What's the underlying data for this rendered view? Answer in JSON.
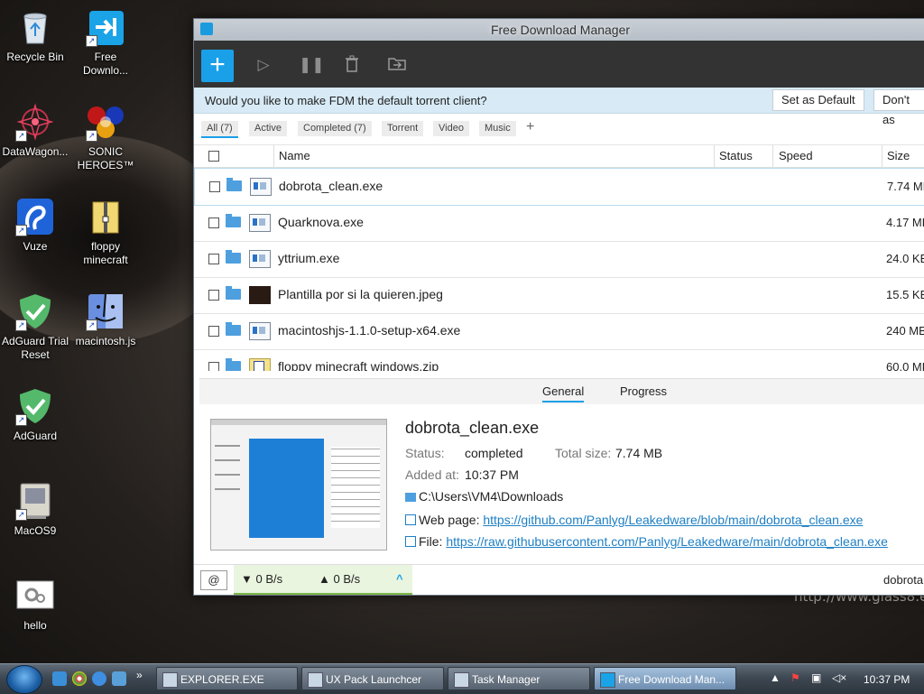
{
  "wallpaper": {
    "watermark": "http://www.glass8.eu"
  },
  "desktop_icons": [
    {
      "label": "Recycle Bin"
    },
    {
      "label": "Free Downlo..."
    },
    {
      "label": "DataWagon..."
    },
    {
      "label": "SONIC HEROES™"
    },
    {
      "label": "Vuze"
    },
    {
      "label": "floppy minecraft"
    },
    {
      "label": "AdGuard Trial Reset"
    },
    {
      "label": "macintosh.js"
    },
    {
      "label": "AdGuard"
    },
    {
      "label": "MacOS9"
    },
    {
      "label": "hello"
    }
  ],
  "window": {
    "title": "Free Download Manager",
    "notice": {
      "message": "Would you like to make FDM the default torrent client?",
      "set_default": "Set as Default",
      "dont_ask": "Don't as"
    },
    "filters": [
      "All (7)",
      "Active",
      "Completed (7)",
      "Torrent",
      "Video",
      "Music"
    ],
    "add_filter": "+",
    "columns": {
      "name": "Name",
      "status": "Status",
      "speed": "Speed",
      "size": "Size"
    },
    "rows": [
      {
        "name": "dobrota_clean.exe",
        "size": "7.74 MB",
        "icon": "exe-icon"
      },
      {
        "name": "Quarknova.exe",
        "size": "4.17 MB",
        "icon": "exe-icon"
      },
      {
        "name": "yttrium.exe",
        "size": "24.0 KB",
        "icon": "exe-icon"
      },
      {
        "name": "Plantilla por si la quieren.jpeg",
        "size": "15.5 KB",
        "icon": "image-icon"
      },
      {
        "name": "macintoshjs-1.1.0-setup-x64.exe",
        "size": "240 MB",
        "icon": "exe-icon"
      },
      {
        "name": "floppy minecraft windows.zip",
        "size": "60.0 MB",
        "icon": "zip-icon"
      }
    ],
    "details": {
      "tabs": [
        "General",
        "Progress"
      ],
      "filename": "dobrota_clean.exe",
      "status_label": "Status:",
      "status_value": "completed",
      "total_label": "Total size:",
      "total_value": "7.74 MB",
      "added_label": "Added at:",
      "added_value": "10:37 PM",
      "folder": "C:\\Users\\VM4\\Downloads",
      "web_label": "Web page:",
      "web_url": "https://github.com/Panlyg/Leakedware/blob/main/dobrota_clean.exe",
      "file_label": "File:",
      "file_url": "https://raw.githubusercontent.com/Panlyg/Leakedware/main/dobrota_clean.exe"
    },
    "statusbar": {
      "down": "▼ 0 B/s",
      "up": "▲ 0 B/s",
      "expand": "^",
      "current": "dobrota"
    }
  },
  "taskbar": {
    "tasks": [
      "EXPLORER.EXE",
      "UX Pack Launchcer",
      "Task Manager",
      "Free Download Man..."
    ],
    "overflow": "»",
    "clock": "10:37 PM"
  },
  "colors": {
    "accent": "#19a0e8",
    "toolbar": "#333333",
    "notice": "#d7eaf5",
    "link": "#1d7fc4"
  }
}
